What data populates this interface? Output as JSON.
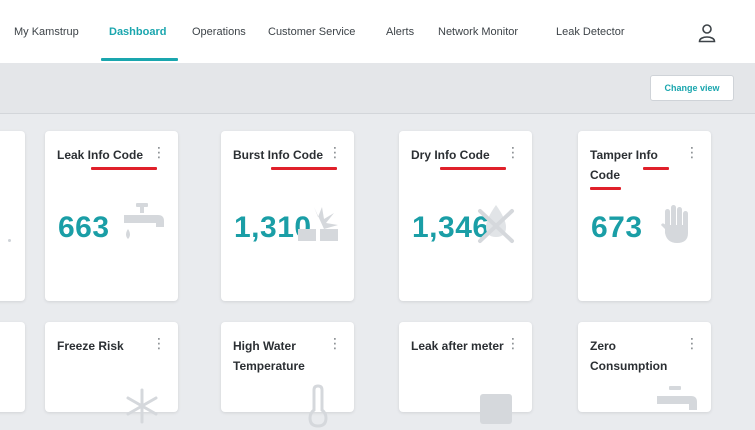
{
  "nav": {
    "items": [
      {
        "label": "My Kamstrup",
        "active": false
      },
      {
        "label": "Dashboard",
        "active": true
      },
      {
        "label": "Operations",
        "active": false
      },
      {
        "label": "Customer Service",
        "active": false
      },
      {
        "label": "Alerts",
        "active": false
      },
      {
        "label": "Network Monitor",
        "active": false
      },
      {
        "label": "Leak Detector",
        "active": false
      }
    ],
    "user_icon": "user-icon"
  },
  "toolbar": {
    "change_view_label": "Change view"
  },
  "cards_row1": [
    {
      "title": "Leak Info Code",
      "value": "663",
      "icon": "faucet-icon",
      "menu": "⋮"
    },
    {
      "title": "Burst Info Code",
      "value": "1,310",
      "icon": "burst-pipe-icon",
      "menu": "⋮"
    },
    {
      "title": "Dry Info Code",
      "value": "1,346",
      "icon": "dry-drop-icon",
      "menu": "⋮"
    },
    {
      "title": "Tamper Info Code",
      "value": "673",
      "icon": "hand-icon",
      "menu": "⋮"
    }
  ],
  "cards_row2": [
    {
      "title": "Freeze Risk",
      "icon": "snowflake-icon",
      "menu": "⋮"
    },
    {
      "title": "High Water Temperature",
      "icon": "thermometer-icon",
      "menu": "⋮"
    },
    {
      "title": "Leak after meter",
      "icon": "meter-icon",
      "menu": "⋮"
    },
    {
      "title": "Zero Consumption",
      "icon": "faucet-icon",
      "menu": "⋮"
    }
  ],
  "colors": {
    "accent": "#1aa6ae",
    "value": "#1a9ea6",
    "annotation_underline": "#e0202a",
    "background": "#e9ebee"
  }
}
